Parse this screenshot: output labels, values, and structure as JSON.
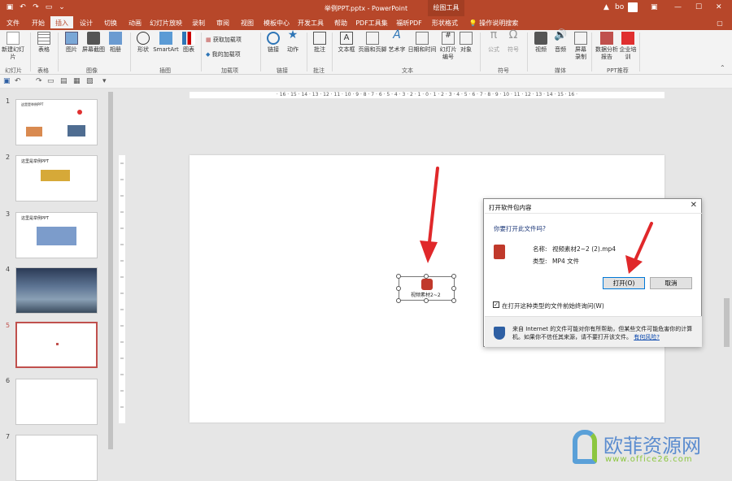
{
  "titlebar": {
    "title": "举例PPT.pptx  -  PowerPoint",
    "context_tab": "绘图工具",
    "user": "bo"
  },
  "tabs": [
    "文件",
    "开始",
    "插入",
    "设计",
    "切换",
    "动画",
    "幻灯片放映",
    "录制",
    "审阅",
    "视图",
    "模板中心",
    "开发工具",
    "帮助",
    "PDF工具集",
    "福昕PDF",
    "形状格式",
    "操作说明搜索"
  ],
  "ribbon": {
    "buttons": [
      "新建幻灯片",
      "表格",
      "图片",
      "屏幕截图",
      "相册",
      "形状",
      "SmartArt",
      "图表",
      "获取加载项",
      "我的加载项",
      "链接",
      "动作",
      "批注",
      "文本框",
      "页眉和页脚",
      "艺术字",
      "日期和时间",
      "幻灯片编号",
      "对象",
      "公式",
      "符号",
      "视频",
      "音频",
      "屏幕录制",
      "数据分析报告",
      "企业培训"
    ],
    "groups": [
      "幻灯片",
      "表格",
      "图像",
      "插图",
      "加载项",
      "链接",
      "批注",
      "文本",
      "符号",
      "媒体",
      "PPT推荐"
    ]
  },
  "slides": [
    {
      "num": "1",
      "caption": "这是是举例PPT"
    },
    {
      "num": "2",
      "caption": "这里是举例PPT"
    },
    {
      "num": "3",
      "caption": "这里是举例PPT"
    },
    {
      "num": "4",
      "caption": ""
    },
    {
      "num": "5",
      "caption": ""
    },
    {
      "num": "6",
      "caption": ""
    },
    {
      "num": "7",
      "caption": ""
    }
  ],
  "ruler": "· 16 · 15 · 14 · 13 · 12 · 11 · 10 · 9 · 8 · 7 · 6 · 5 · 4 · 3 · 2 · 1 · 0 · 1 · 2 · 3 · 4 · 5 · 6 · 7 · 8 · 9 · 10 · 11 · 12 · 13 · 14 · 15 · 16 ·",
  "media_object": {
    "label": "视频素材2~2"
  },
  "dialog": {
    "title": "打开软件包内容",
    "question": "你要打开此文件吗?",
    "name_label": "名称:",
    "name_value": "视频素材2~2 (2).mp4",
    "type_label": "类型:",
    "type_value": "MP4 文件",
    "open_btn": "打开(O)",
    "cancel_btn": "取消",
    "checkbox_label": "在打开这种类型的文件前始终询问(W)",
    "checked": true,
    "warning": "来自 Internet 的文件可能对你有所帮助，但某些文件可能危害你的计算机。如果你不信任其来源，请不要打开该文件。",
    "risk_link": "有何风险?"
  },
  "watermark": {
    "text": "欧菲资源网",
    "url": "www.office26.com"
  },
  "colors": {
    "accent": "#b7472a",
    "arrow": "#e0282a"
  }
}
